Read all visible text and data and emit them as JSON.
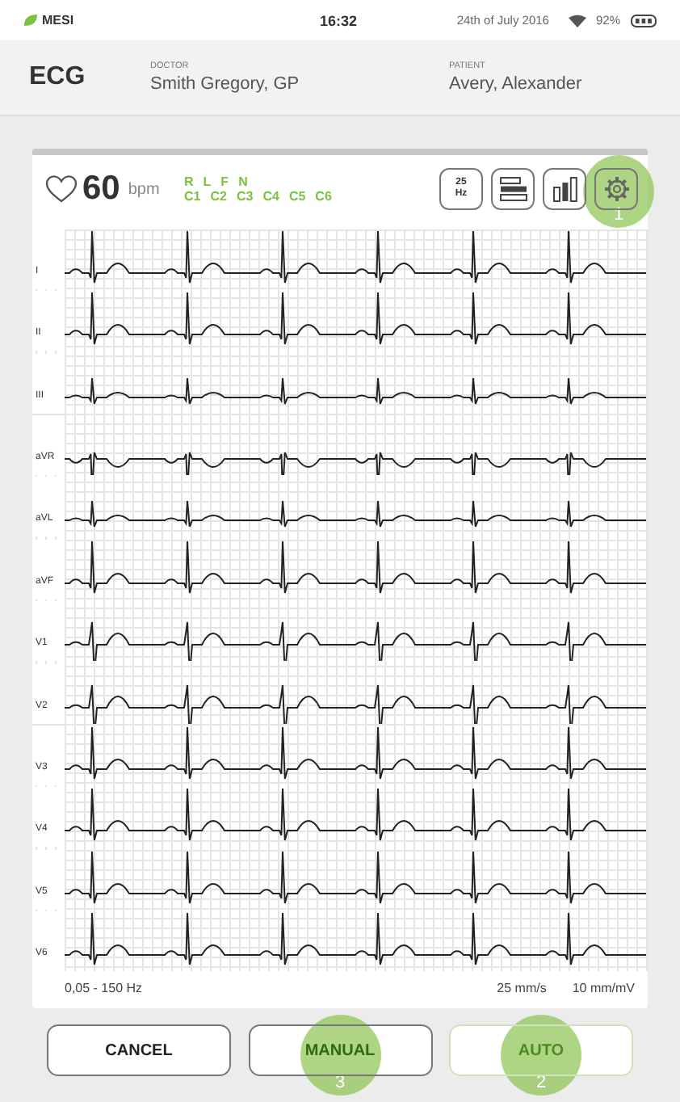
{
  "status_bar": {
    "app": "MESI",
    "time": "16:32",
    "date": "24th of July 2016",
    "battery": "92%"
  },
  "header": {
    "title": "ECG",
    "doctor": {
      "label": "DOCTOR",
      "value": "Smith Gregory, GP"
    },
    "patient": {
      "label": "PATIENT",
      "value": "Avery, Alexander"
    }
  },
  "monitor": {
    "heart_rate": "60",
    "unit": "bpm",
    "electrodes_top": [
      "R",
      "L",
      "F",
      "N"
    ],
    "electrodes_bottom": [
      "C1",
      "C2",
      "C3",
      "C4",
      "C5",
      "C6"
    ],
    "tools": [
      {
        "kind": "text",
        "label": "25",
        "sublabel": "Hz"
      },
      {
        "kind": "layout"
      },
      {
        "kind": "bars"
      },
      {
        "kind": "gear",
        "callout": "1"
      }
    ],
    "leads": [
      {
        "label": "I",
        "kind": "upright"
      },
      {
        "label": "II",
        "kind": "upright"
      },
      {
        "label": "III",
        "kind": "low"
      },
      {
        "label": "aVR",
        "kind": "inverted"
      },
      {
        "label": "aVL",
        "kind": "low"
      },
      {
        "label": "aVF",
        "kind": "upright"
      },
      {
        "label": "V1",
        "kind": "deep"
      },
      {
        "label": "V2",
        "kind": "deep"
      },
      {
        "label": "V3",
        "kind": "upright"
      },
      {
        "label": "V4",
        "kind": "upright"
      },
      {
        "label": "V5",
        "kind": "upright"
      },
      {
        "label": "V6",
        "kind": "upright"
      }
    ],
    "filter": "0,05 - 150 Hz",
    "speed": "25 mm/s",
    "gain": "10 mm/mV"
  },
  "buttons": [
    {
      "label": "CANCEL",
      "kind": "plain",
      "disabled": false
    },
    {
      "label": "MANUAL",
      "kind": "accent",
      "disabled": false,
      "callout": "3"
    },
    {
      "label": "AUTO",
      "kind": "accent",
      "disabled": true,
      "callout": "2"
    }
  ]
}
